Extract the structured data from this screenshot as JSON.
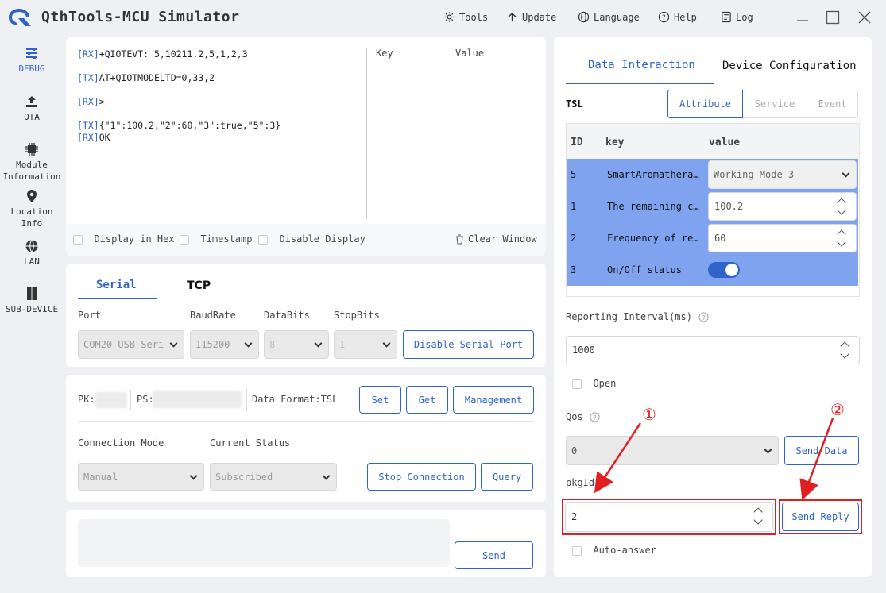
{
  "app": {
    "title": "QthTools-MCU Simulator"
  },
  "menu": [
    {
      "label": "Tools",
      "icon": "gear-icon"
    },
    {
      "label": "Update",
      "icon": "arrow-up-icon"
    },
    {
      "label": "Language",
      "icon": "globe-icon"
    },
    {
      "label": "Help",
      "icon": "help-circle-icon"
    },
    {
      "label": "Log",
      "icon": "log-document-icon"
    }
  ],
  "sidebar": [
    {
      "label": "DEBUG",
      "icon": "sliders-icon",
      "active": true
    },
    {
      "label": "OTA",
      "icon": "upload-tray-icon"
    },
    {
      "label": "Module Information",
      "lines": [
        "Module",
        "Information"
      ],
      "icon": "chip-icon"
    },
    {
      "label": "Location Info",
      "lines": [
        "Location",
        "Info"
      ],
      "icon": "location-pin-icon"
    },
    {
      "label": "LAN",
      "icon": "globe-icon"
    },
    {
      "label": "SUB-DEVICE",
      "icon": "book-icon"
    }
  ],
  "log": {
    "lines": [
      {
        "tag": "[RX]",
        "text": "+QIOTEVT: 5,10211,2,5,1,2,3"
      },
      {
        "tag": "[TX]",
        "text": "AT+QIOTMODELTD=0,33,2"
      },
      {
        "tag": "[RX]",
        "text": ">"
      },
      {
        "tag": "[TX]",
        "text": "{\"1\":100.2,\"2\":60,\"3\":true,\"5\":3}"
      },
      {
        "tag": "[RX]",
        "text": "OK"
      }
    ],
    "kv_headers": {
      "key": "Key",
      "value": "Value"
    },
    "options": {
      "hex": "Display in Hex",
      "timestamp": "Timestamp",
      "disable": "Disable Display"
    },
    "clear": "Clear Window"
  },
  "connection": {
    "tabs": [
      "Serial",
      "TCP"
    ],
    "active_tab": "Serial",
    "labels": {
      "port": "Port",
      "baud": "BaudRate",
      "databits": "DataBits",
      "stopbits": "StopBits"
    },
    "values": {
      "port": "COM20-USB Seri",
      "baud": "115200",
      "databits": "8",
      "stopbits": "1"
    },
    "disable_btn": "Disable Serial Port"
  },
  "product": {
    "pk_label": "PK:",
    "ps_label": "PS:",
    "format": "Data Format:TSL",
    "buttons": {
      "set": "Set",
      "get": "Get",
      "management": "Management"
    },
    "mode_label": "Connection Mode",
    "status_label": "Current Status",
    "mode_value": "Manual",
    "status_value": "Subscribed",
    "stop_btn": "Stop Connection",
    "query_btn": "Query"
  },
  "send_box": {
    "text": "",
    "send": "Send"
  },
  "right": {
    "tabs": [
      "Data Interaction",
      "Device Configuration"
    ],
    "active_tab": "Data Interaction",
    "tsl_label": "TSL",
    "subtabs": [
      "Attribute",
      "Service",
      "Event"
    ],
    "active_subtab": "Attribute",
    "table_headers": [
      "ID",
      "key",
      "value"
    ],
    "rows": [
      {
        "id": "5",
        "key": "SmartAromathera…",
        "value": "Working Mode 3",
        "type": "select"
      },
      {
        "id": "1",
        "key": "The remaining c…",
        "value": "100.2",
        "type": "number"
      },
      {
        "id": "2",
        "key": "Frequency of re…",
        "value": "60",
        "type": "number"
      },
      {
        "id": "3",
        "key": "On/Off status",
        "value": true,
        "type": "switch"
      }
    ],
    "interval_label": "Reporting Interval(ms)",
    "interval_value": "1000",
    "open_label": "Open",
    "qos_label": "Qos",
    "qos_value": "0",
    "send_data": "Send Data",
    "pkgid_label": "pkgId",
    "pkgid_value": "2",
    "send_reply": "Send Reply",
    "auto_answer": "Auto-answer",
    "annotations": [
      "①",
      "②"
    ],
    "accent": "#2f63c9",
    "highlight": "#e02020"
  }
}
